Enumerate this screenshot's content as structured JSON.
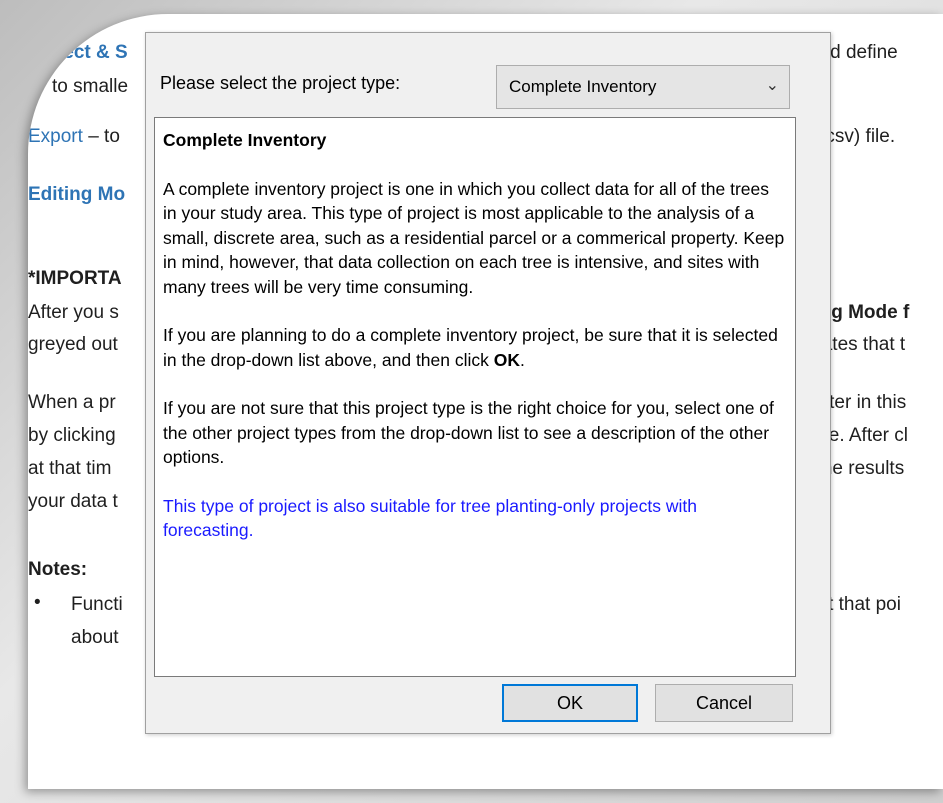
{
  "background_doc": {
    "l1_left": "ject & S",
    "l1_right": "and define",
    "l2_left": "to smalle",
    "l3_export": "Export",
    "l3_rest": " – to",
    "l3_right": "s” (csv) file.",
    "l4_left": "Editing Mo",
    "l5_left": "*IMPORTA",
    "l6_left": "After you s",
    "l6_right": "ting Mode f",
    "l7_left": "greyed out",
    "l7_right": "icates that t",
    "l8_left": "When a pr",
    "l8_right": "enter in this",
    "l9_left": "by clicking",
    "l9_right": "ble. After cl",
    "l10_left": "at that tim",
    "l10_right": ", the results",
    "l11_left": "your data t",
    "notes_heading": "Notes:",
    "bullet": "•",
    "l13_left": "Functi",
    "l13_right": "l at that poi",
    "l14_left": "about "
  },
  "dialog": {
    "select_label": "Please select the project type:",
    "select_value": "Complete Inventory",
    "description": {
      "heading": "Complete Inventory",
      "p1": "A complete inventory project is one in which you collect data for all of the trees in your study area. This type of project is most applicable to the analysis of a small, discrete area, such as a residential parcel or a commerical property. Keep in mind, however, that data collection on each tree is intensive, and sites with many trees will be very time consuming.",
      "p2_before": "If you are planning to do a complete inventory project, be sure that it is selected in the drop-down list above, and then click ",
      "p2_bold": "OK",
      "p2_after": ".",
      "p3": "If you are not sure that this project type is the right choice for you, select one of the other project types from the drop-down list to see a description of the other options.",
      "note": "This type of project is also suitable for tree planting-only projects with forecasting."
    },
    "ok_label": "OK",
    "cancel_label": "Cancel"
  }
}
